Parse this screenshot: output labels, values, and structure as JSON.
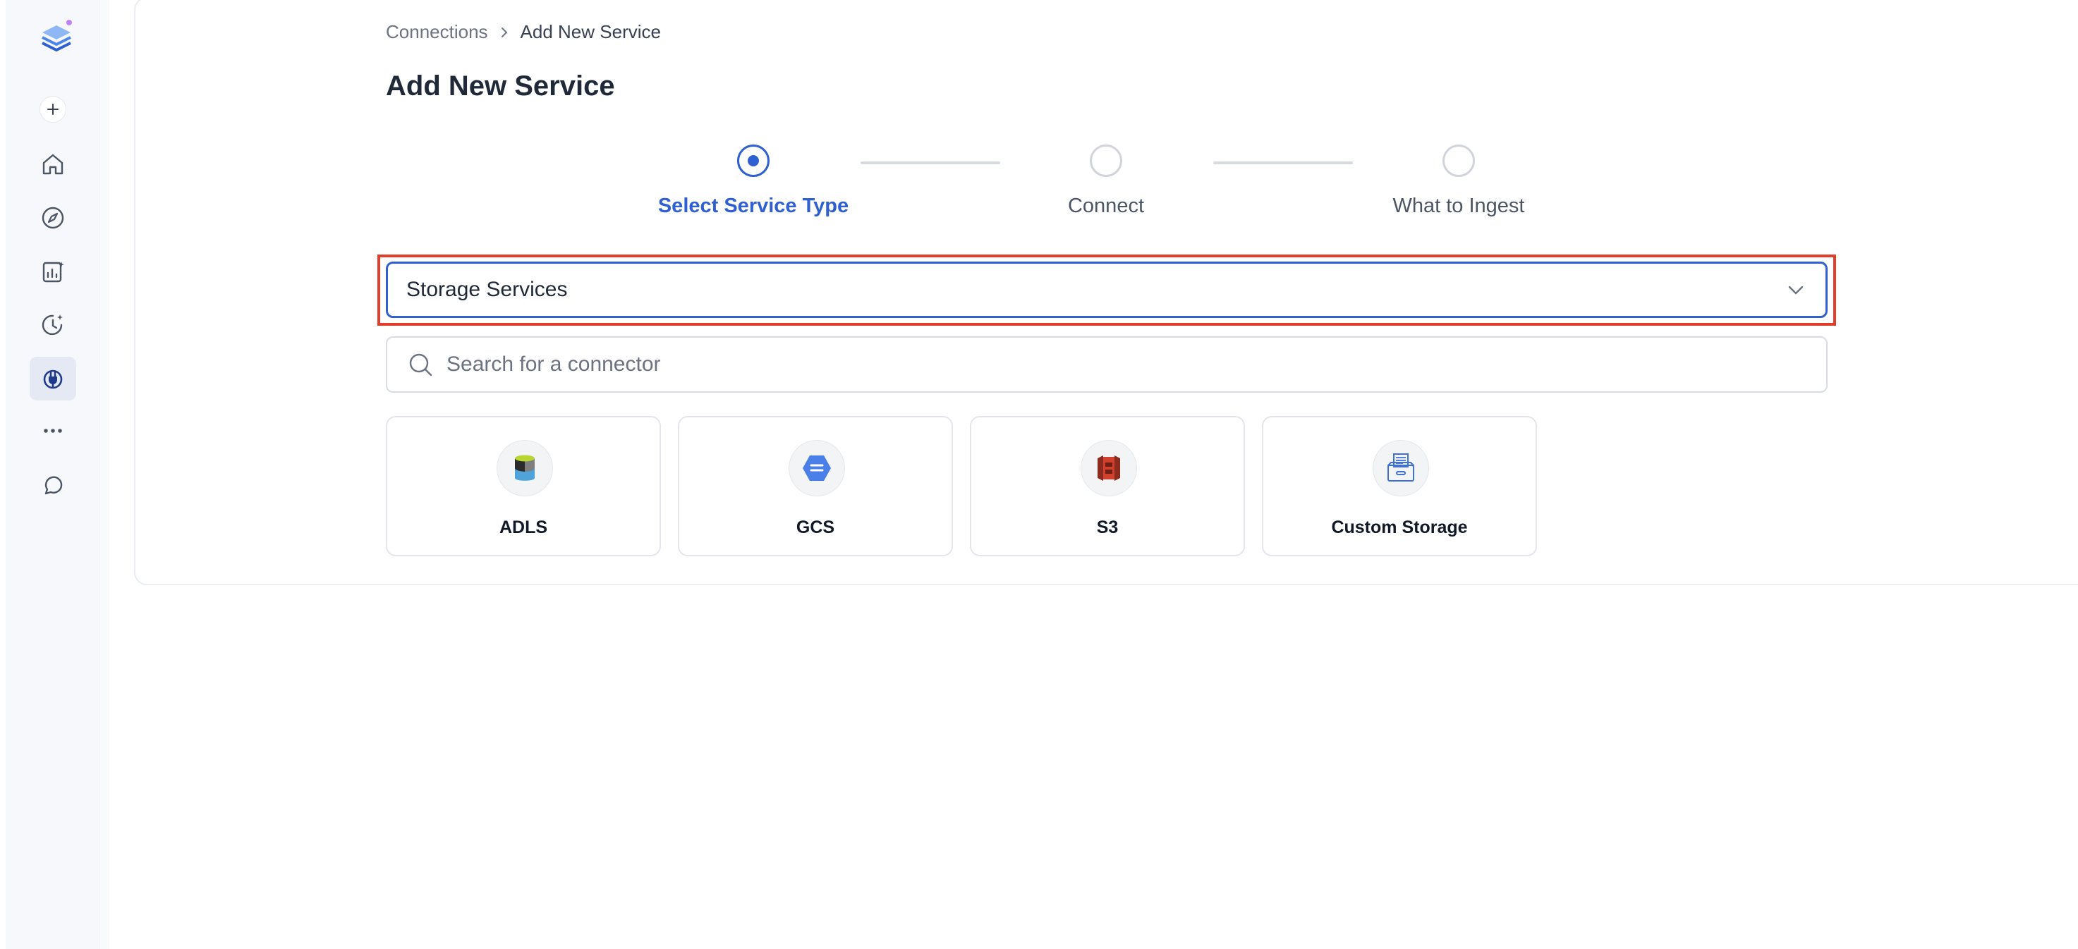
{
  "breadcrumb": {
    "parent": "Connections",
    "current": "Add New Service"
  },
  "page_title": "Add New Service",
  "steps": [
    {
      "label": "Select Service Type",
      "state": "active"
    },
    {
      "label": "Connect",
      "state": "pending"
    },
    {
      "label": "What to Ingest",
      "state": "pending"
    }
  ],
  "service_type_select": {
    "value": "Storage Services"
  },
  "search": {
    "placeholder": "Search for a connector",
    "value": ""
  },
  "connectors": [
    {
      "label": "ADLS",
      "icon": "adls-icon"
    },
    {
      "label": "GCS",
      "icon": "gcs-icon"
    },
    {
      "label": "S3",
      "icon": "s3-icon"
    },
    {
      "label": "Custom Storage",
      "icon": "custom-storage-icon"
    }
  ],
  "sidebar": {
    "items": [
      {
        "icon": "plus-icon"
      },
      {
        "icon": "home-icon"
      },
      {
        "icon": "compass-icon"
      },
      {
        "icon": "insights-icon"
      },
      {
        "icon": "observability-icon"
      },
      {
        "icon": "settings-plug-icon",
        "active": true
      },
      {
        "icon": "more-icon"
      },
      {
        "icon": "chat-icon"
      }
    ]
  },
  "colors": {
    "accent": "#2f5fd0",
    "highlight": "#e23d2b",
    "sidebar_bg": "#f6f8fc"
  }
}
